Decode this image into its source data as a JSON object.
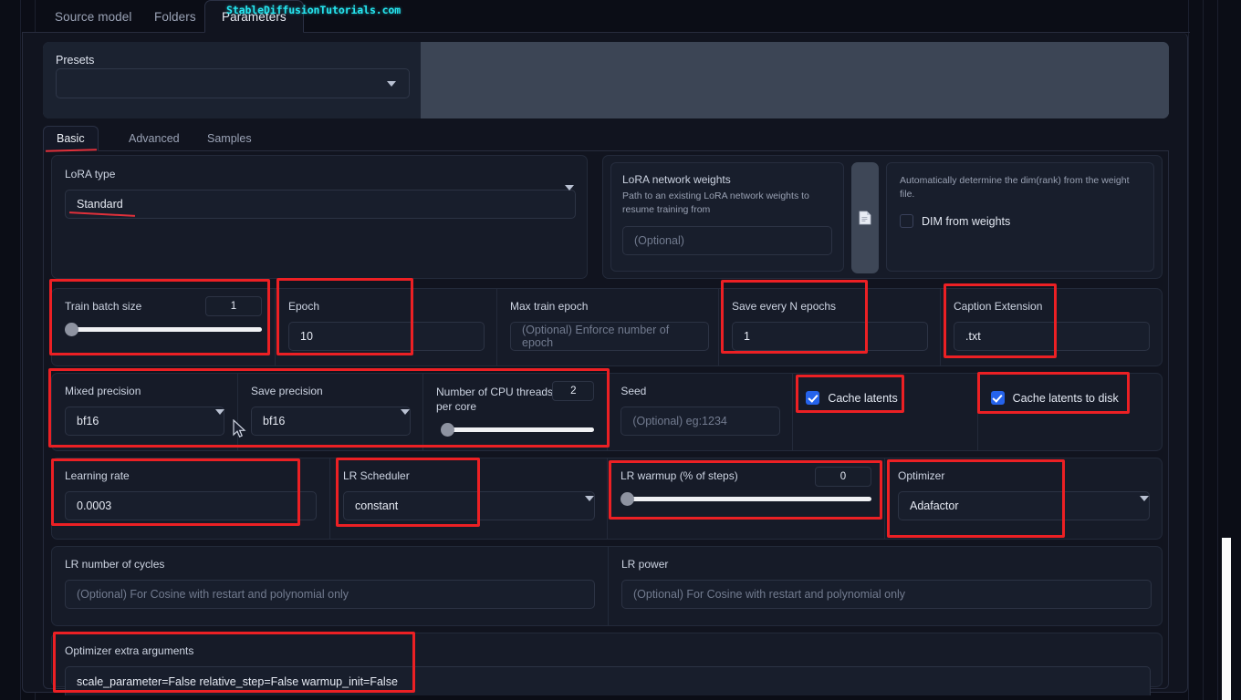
{
  "watermark": "StableDiffusionTutorials.com",
  "top_tabs": [
    {
      "label": "Source model",
      "active": false
    },
    {
      "label": "Folders",
      "active": false
    },
    {
      "label": "Parameters",
      "active": true
    }
  ],
  "presets": {
    "label": "Presets",
    "value": "",
    "caret_icon": "chevron-down-icon"
  },
  "inner_tabs": [
    {
      "label": "Basic",
      "active": true
    },
    {
      "label": "Advanced",
      "active": false
    },
    {
      "label": "Samples",
      "active": false
    }
  ],
  "lora_type": {
    "label": "LoRA type",
    "value": "Standard"
  },
  "lora_network_weights": {
    "label": "LoRA network weights",
    "description": "Path to an existing LoRA network weights to resume training from",
    "placeholder": "(Optional)",
    "value": "",
    "file_icon": "document-icon"
  },
  "dim_from_weights": {
    "description": "Automatically determine the dim(rank) from the weight file.",
    "label": "DIM from weights",
    "checked": false
  },
  "train_batch_size": {
    "label": "Train batch size",
    "value": "1",
    "slider_percent": 0
  },
  "epoch": {
    "label": "Epoch",
    "value": "10"
  },
  "max_train_epoch": {
    "label": "Max train epoch",
    "placeholder": "(Optional) Enforce number of epoch",
    "value": ""
  },
  "save_every_n_epochs": {
    "label": "Save every N epochs",
    "value": "1"
  },
  "caption_extension": {
    "label": "Caption Extension",
    "value": ".txt"
  },
  "mixed_precision": {
    "label": "Mixed precision",
    "value": "bf16"
  },
  "save_precision": {
    "label": "Save precision",
    "value": "bf16"
  },
  "cpu_threads": {
    "label": "Number of CPU threads per core",
    "value": "2",
    "slider_percent": 3
  },
  "seed": {
    "label": "Seed",
    "placeholder": "(Optional) eg:1234",
    "value": ""
  },
  "cache_latents": {
    "label": "Cache latents",
    "checked": true
  },
  "cache_latents_to_disk": {
    "label": "Cache latents to disk",
    "checked": true
  },
  "learning_rate": {
    "label": "Learning rate",
    "value": "0.0003"
  },
  "lr_scheduler": {
    "label": "LR Scheduler",
    "value": "constant"
  },
  "lr_warmup": {
    "label": "LR warmup (% of steps)",
    "value": "0",
    "slider_percent": 0
  },
  "optimizer": {
    "label": "Optimizer",
    "value": "Adafactor"
  },
  "lr_number_of_cycles": {
    "label": "LR number of cycles",
    "placeholder": "(Optional) For Cosine with restart and polynomial only",
    "value": ""
  },
  "lr_power": {
    "label": "LR power",
    "placeholder": "(Optional) For Cosine with restart and polynomial only",
    "value": ""
  },
  "optimizer_extra_arguments": {
    "label": "Optimizer extra arguments",
    "value": "scale_parameter=False relative_step=False warmup_init=False"
  },
  "colors": {
    "annotation_red": "#ec2024",
    "checkbox_blue": "#2563eb",
    "watermark_cyan": "#25e6f0",
    "panel_bg": "#11141f",
    "card_bg": "#161b28"
  }
}
